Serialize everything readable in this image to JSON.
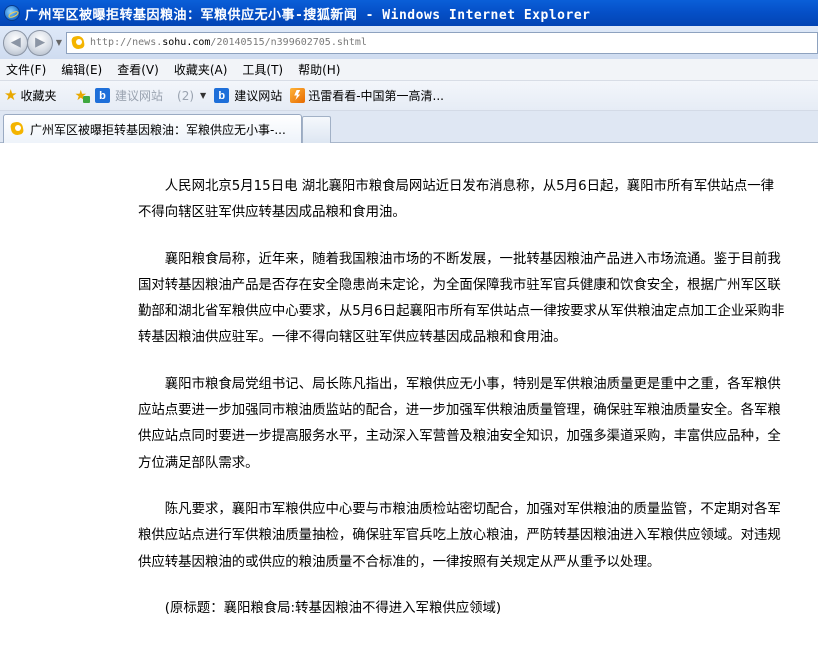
{
  "window": {
    "title": "广州军区被曝拒转基因粮油：军粮供应无小事-搜狐新闻 - Windows Internet Explorer"
  },
  "nav": {
    "back_icon": "back-arrow-icon",
    "forward_icon": "forward-arrow-icon",
    "url_prefix": "http://news.",
    "url_host": "sohu.com",
    "url_path": "/20140515/n399602705.shtml"
  },
  "menu": {
    "items": [
      "文件(F)",
      "编辑(E)",
      "查看(V)",
      "收藏夹(A)",
      "工具(T)",
      "帮助(H)"
    ]
  },
  "favorites": {
    "label": "收藏夹",
    "suggested_sites_greyed": "建议网站",
    "suggested_count": "(2)",
    "suggested_sites": "建议网站",
    "xunlei": "迅雷看看-中国第一高清..."
  },
  "tab": {
    "label": "广州军区被曝拒转基因粮油：军粮供应无小事-..."
  },
  "article": {
    "paragraphs": [
      "人民网北京5月15日电 湖北襄阳市粮食局网站近日发布消息称，从5月6日起，襄阳市所有军供站点一律不得向辖区驻军供应转基因成品粮和食用油。",
      "襄阳粮食局称，近年来，随着我国粮油市场的不断发展，一批转基因粮油产品进入市场流通。鉴于目前我国对转基因粮油产品是否存在安全隐患尚未定论，为全面保障我市驻军官兵健康和饮食安全，根据广州军区联勤部和湖北省军粮供应中心要求，从5月6日起襄阳市所有军供站点一律按要求从军供粮油定点加工企业采购非转基因粮油供应驻军。一律不得向辖区驻军供应转基因成品粮和食用油。",
      "襄阳市粮食局党组书记、局长陈凡指出，军粮供应无小事，特别是军供粮油质量更是重中之重，各军粮供应站点要进一步加强同市粮油质监站的配合，进一步加强军供粮油质量管理，确保驻军粮油质量安全。各军粮供应站点同时要进一步提高服务水平，主动深入军营普及粮油安全知识，加强多渠道采购，丰富供应品种，全方位满足部队需求。",
      "陈凡要求，襄阳市军粮供应中心要与市粮油质检站密切配合，加强对军供粮油的质量监管，不定期对各军粮供应站点进行军供粮油质量抽检，确保驻军官兵吃上放心粮油，严防转基因粮油进入军粮供应领域。对违规供应转基因粮油的或供应的粮油质量不合标准的，一律按照有关规定从严从重予以处理。"
    ],
    "source": "(原标题：襄阳粮食局:转基因粮油不得进入军粮供应领域)"
  }
}
